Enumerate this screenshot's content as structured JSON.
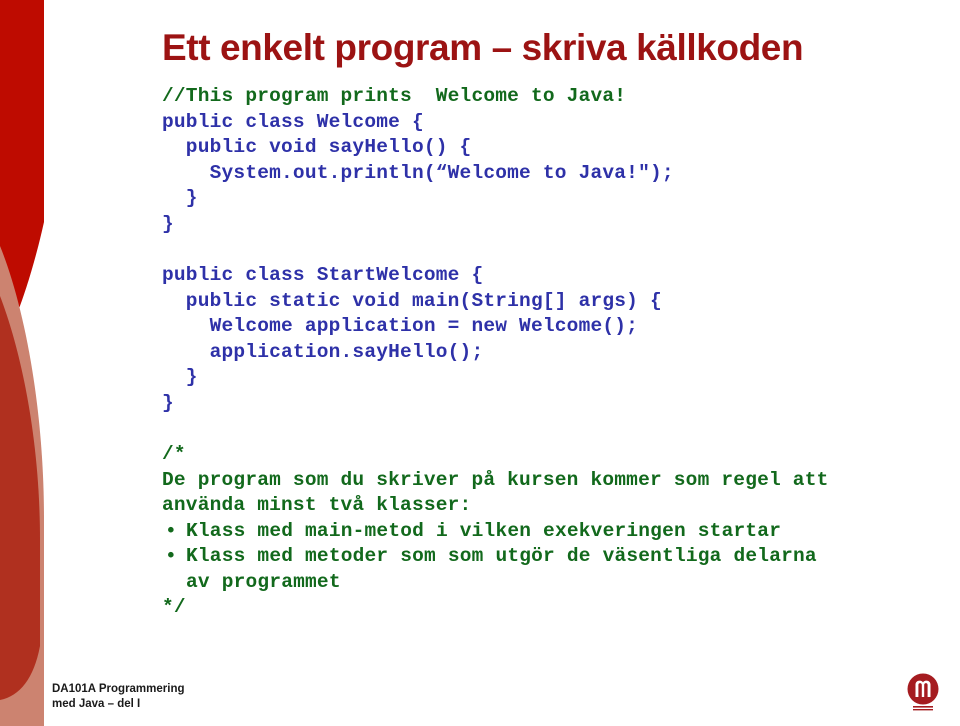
{
  "slide": {
    "title": "Ett enkelt program – skriva källkoden",
    "title_color": "#9C1313",
    "background_color": "#ffffff"
  },
  "colors": {
    "comment_green": "#12691C",
    "code_blue": "#2E31A8",
    "deco_bright_red": "#BE0B00",
    "deco_terracotta": "#B0301F",
    "deco_salmon": "#CC8370",
    "logo_red": "#A51C20"
  },
  "code": {
    "block1": [
      {
        "text": "//This program prints  Welcome to Java!",
        "kind": "comment"
      },
      {
        "text": "public class Welcome {",
        "kind": "code"
      },
      {
        "text": "  public void sayHello() {",
        "kind": "code"
      },
      {
        "text": "    System.out.println(“Welcome to Java!\");",
        "kind": "code"
      },
      {
        "text": "  }",
        "kind": "code"
      },
      {
        "text": "}",
        "kind": "code"
      }
    ],
    "block2": [
      {
        "text": "public class StartWelcome {",
        "kind": "code"
      },
      {
        "text": "  public static void main(String[] args) {",
        "kind": "code"
      },
      {
        "text": "    Welcome application = new Welcome();",
        "kind": "code"
      },
      {
        "text": "    application.sayHello();",
        "kind": "code"
      },
      {
        "text": "  }",
        "kind": "code"
      },
      {
        "text": "}",
        "kind": "code"
      }
    ],
    "comment_block": {
      "open": "/*",
      "intro_line1": "De program som du skriver på kursen kommer som regel att",
      "intro_line2": "använda minst två klasser:",
      "bullet_char": "•",
      "bullets": [
        {
          "line1": "Klass med main-metod i vilken exekveringen startar",
          "line2": ""
        },
        {
          "line1": "Klass med metoder som som utgör de väsentliga delarna",
          "line2": "av programmet"
        }
      ],
      "close": "*/"
    }
  },
  "footer": {
    "line1": "DA101A Programmering",
    "line2": "med Java – del I",
    "logo_name": "mah-university-logo"
  }
}
